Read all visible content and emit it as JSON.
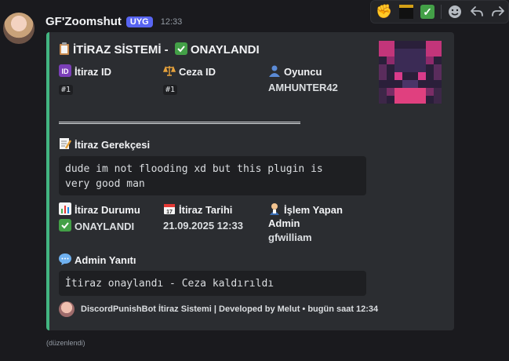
{
  "message": {
    "username": "GF'Zoomshut",
    "role_tag": "UYG",
    "timestamp": "12:33",
    "edited_label": "(düzenlendi)"
  },
  "toolbar": {
    "reactions": [
      "fist-emoji",
      "kaaba-emoji",
      "check-mark-emoji"
    ],
    "actions": [
      "add-reaction",
      "reply",
      "forward"
    ]
  },
  "embed": {
    "accent_color": "#43b581",
    "title_prefix": "İTİRAZ SİSTEMİ -",
    "title_status": "ONAYLANDI",
    "fields_row1": [
      {
        "icon": "id-icon",
        "name": "İtiraz ID",
        "value": "#1"
      },
      {
        "icon": "scales-icon",
        "name": "Ceza ID",
        "value": "#1"
      },
      {
        "icon": "user-icon",
        "name": "Oyuncu",
        "value": "AMHUNTER42"
      }
    ],
    "reason_label": "İtiraz Gerekçesi",
    "reason_text_line1": "dude im not flooding xd but this plugin is",
    "reason_text_line2": "very good man",
    "fields_row2": [
      {
        "icon": "chart-icon",
        "name": "İtiraz Durumu",
        "value": "ONAYLANDI"
      },
      {
        "icon": "calendar-icon",
        "name": "İtiraz Tarihi",
        "value": "21.09.2025 12:33"
      },
      {
        "icon": "admin-icon",
        "name": "İşlem Yapan Admin",
        "value": "gfwilliam"
      }
    ],
    "admin_reply_label": "Admin Yanıtı",
    "admin_reply_text": "İtiraz onaylandı - Ceza kaldırıldı",
    "footer_text": "DiscordPunishBot İtiraz Sistemi | Developed by Melut • bugün saat 12:34"
  }
}
